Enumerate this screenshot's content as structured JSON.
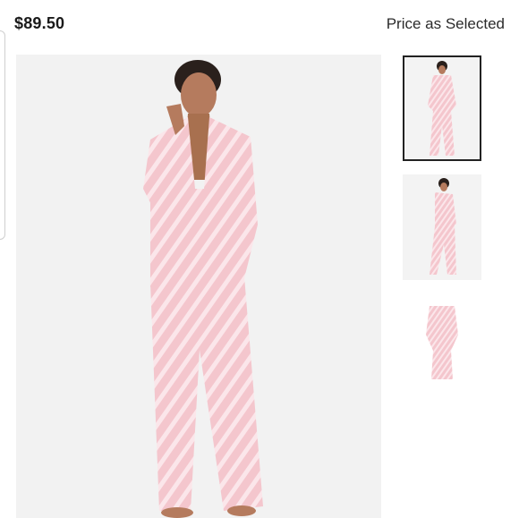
{
  "product": {
    "price": "$89.50",
    "price_note": "Price as Selected"
  },
  "gallery": {
    "main_image_alt": "Model wearing pink striped satin pajama set",
    "thumbnails": [
      {
        "alt": "Front view thumbnail",
        "selected": true
      },
      {
        "alt": "Side view thumbnail",
        "selected": false
      },
      {
        "alt": "Flat lay thumbnail",
        "selected": false
      }
    ]
  },
  "colors": {
    "pajama_pink": "#f4c9cf",
    "stripe": "#fbe7ea",
    "background": "#f1f1f1"
  }
}
